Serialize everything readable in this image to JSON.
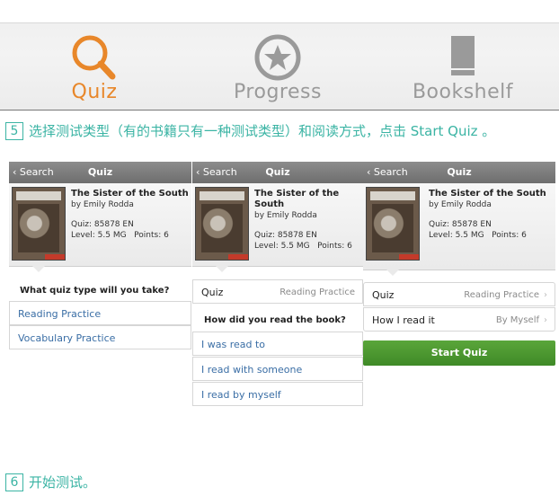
{
  "tabs": [
    {
      "label": "Quiz",
      "icon": "search-icon",
      "active": true
    },
    {
      "label": "Progress",
      "icon": "star-icon",
      "active": false
    },
    {
      "label": "Bookshelf",
      "icon": "book-icon",
      "active": false
    }
  ],
  "colors": {
    "active_tab": "#e8872a",
    "inactive_tab": "#9a9a9a",
    "caption": "#3bb4a4",
    "link": "#3a6ea5",
    "start_button": "#4a9630"
  },
  "step5": {
    "number": "5",
    "text": "选择测试类型（有的书籍只有一种测试类型）和阅读方式，点击 Start Quiz 。"
  },
  "step6": {
    "number": "6",
    "text": "开始测试。"
  },
  "book": {
    "title": "The Sister of the South",
    "author": "by Emily Rodda",
    "quiz": "Quiz: 85878 EN",
    "level": "Level: 5.5 MG",
    "points": "Points: 6"
  },
  "panel1": {
    "back": "Search",
    "title": "Quiz",
    "question": "What quiz type will you take?",
    "options": [
      "Reading Practice",
      "Vocabulary Practice"
    ]
  },
  "panel2": {
    "back": "Search",
    "title": "Quiz",
    "quiz_row": {
      "label": "Quiz",
      "value": "Reading Practice"
    },
    "question": "How did you read the book?",
    "options": [
      "I was read to",
      "I read with someone",
      "I read by myself"
    ]
  },
  "panel3": {
    "back": "Search",
    "title": "Quiz",
    "quiz_row": {
      "label": "Quiz",
      "value": "Reading Practice"
    },
    "read_row": {
      "label": "How I read it",
      "value": "By Myself"
    },
    "button": "Start Quiz"
  }
}
